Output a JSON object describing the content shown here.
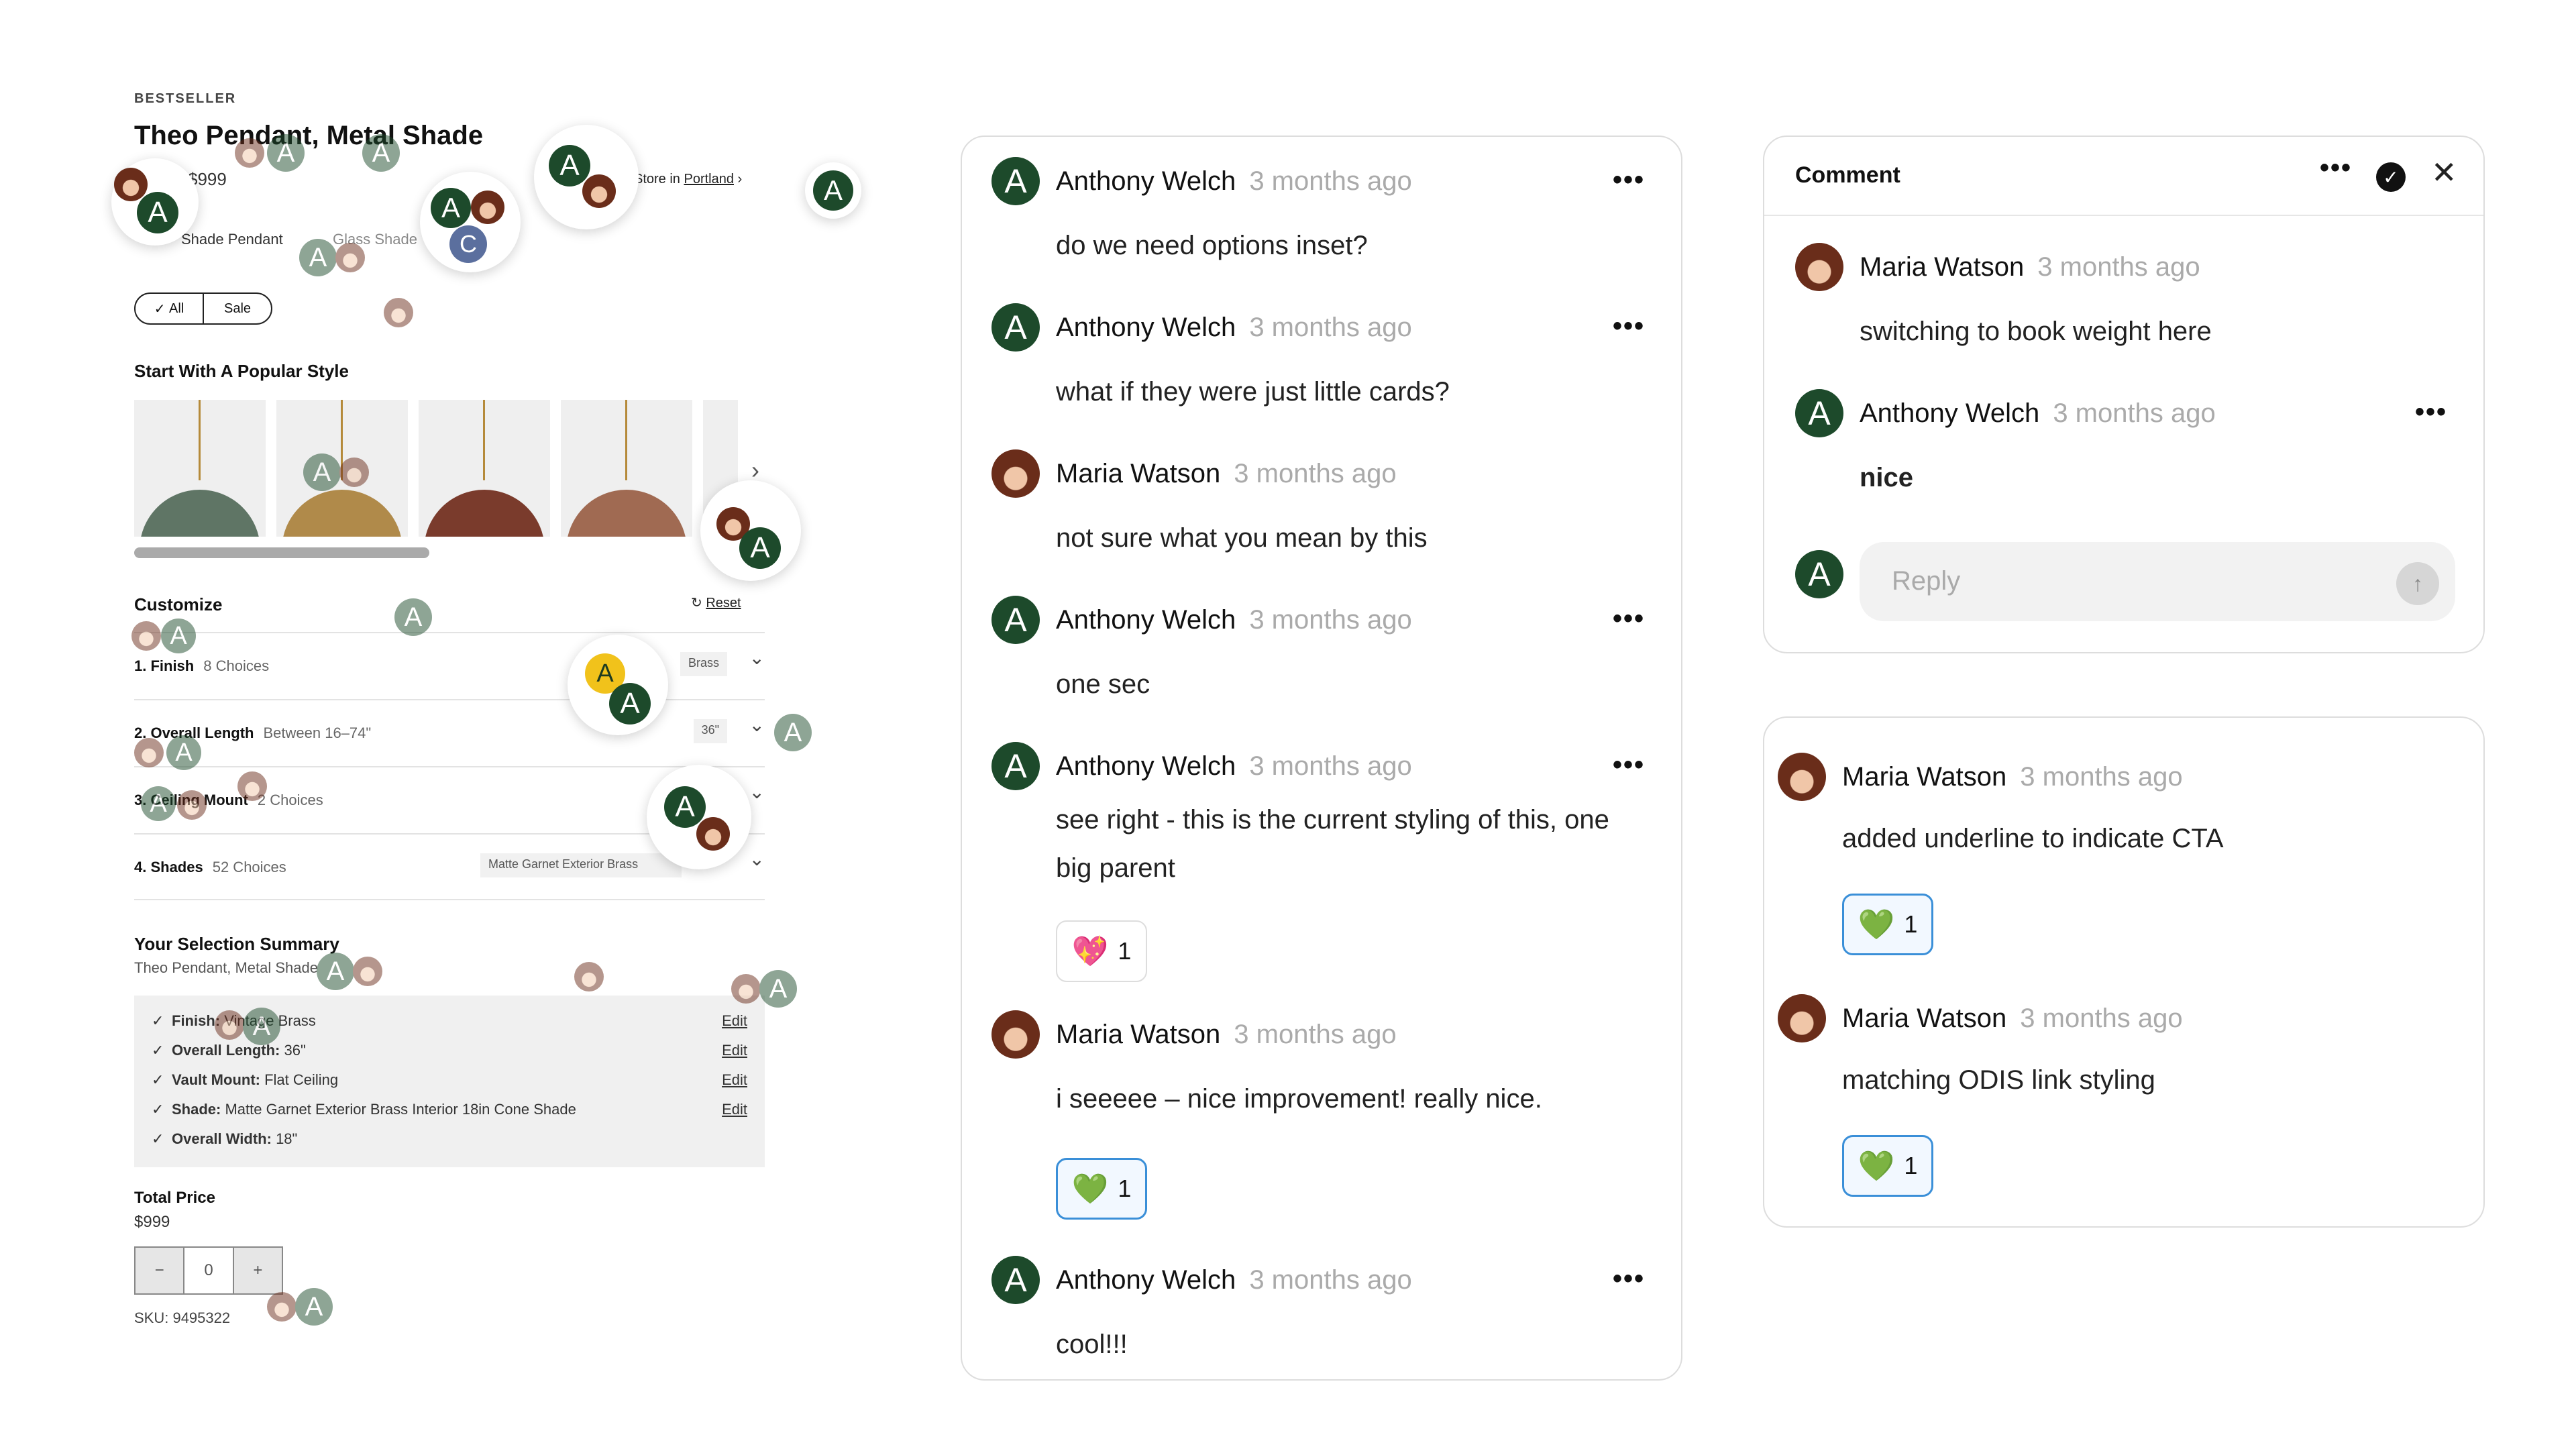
{
  "product": {
    "eyebrow": "BESTSELLER",
    "title": "Theo Pendant, Metal Shade",
    "price": "$999",
    "store_prefix": "Store in ",
    "store_city": "Portland",
    "store_chevron": "›",
    "variant_tabs": [
      "Shade Pendant",
      "Glass Shade"
    ],
    "filters": [
      "All",
      "Sale"
    ],
    "filter_check": "✓",
    "popular_heading": "Start With A Popular Style",
    "thumbnail_shade_colors": [
      "#5f7565",
      "#b08a4a",
      "#7a3b2c",
      "#a06a52",
      "#d8d8d8"
    ],
    "next_arrow": "›",
    "customize_heading": "Customize",
    "reset_icon": "↻",
    "reset_label": "Reset",
    "options": [
      {
        "label": "1.  Finish",
        "sub": "8 Choices",
        "value": "Brass",
        "chevron": "⌄"
      },
      {
        "label": "2.  Overall Length",
        "sub": "Between 16–74\"",
        "value": "36\"",
        "chevron": "⌄"
      },
      {
        "label": "3.  Ceiling Mount",
        "sub": "2 Choices",
        "value": "",
        "chevron": "⌄"
      },
      {
        "label": "4.  Shades",
        "sub": "52 Choices",
        "value": "Matte Garnet Exterior Brass",
        "chevron": "⌄"
      }
    ],
    "summary_heading": "Your Selection Summary",
    "summary_sub": "Theo Pendant, Metal Shade",
    "summary_check": "✓",
    "summary_lines": [
      {
        "key": "Finish:",
        "value": "Vintage Brass",
        "edit": "Edit"
      },
      {
        "key": "Overall Length:",
        "value": "36\"",
        "edit": "Edit"
      },
      {
        "key": "Vault Mount:",
        "value": "Flat Ceiling",
        "edit": "Edit"
      },
      {
        "key": "Shade:",
        "value": "Matte Garnet Exterior Brass Interior 18in Cone Shade",
        "edit": "Edit"
      },
      {
        "key": "Overall Width:",
        "value": "18\"",
        "edit": ""
      }
    ],
    "total_label": "Total Price",
    "total_value": "$999",
    "qty_minus": "−",
    "qty_value": "0",
    "qty_plus": "+",
    "sku": "SKU: 9495322"
  },
  "avatar_letters": {
    "anthony": "A",
    "c_user": "C"
  },
  "thread": {
    "more_icon": "•••",
    "comments": [
      {
        "author": "Anthony Welch",
        "time": "3 months ago",
        "body": "do we need options inset?",
        "avatar": "A"
      },
      {
        "author": "Anthony Welch",
        "time": "3 months ago",
        "body": "what if they were just little cards?",
        "avatar": "A"
      },
      {
        "author": "Maria Watson",
        "time": "3 months ago",
        "body": "not sure what you mean by this",
        "avatar": ""
      },
      {
        "author": "Anthony Welch",
        "time": "3 months ago",
        "body": "one sec",
        "avatar": "A"
      },
      {
        "author": "Anthony Welch",
        "time": "3 months ago",
        "body": "see right - this is the current styling of this, one big parent",
        "avatar": "A",
        "reaction": {
          "emoji": "💖",
          "count": "1"
        }
      },
      {
        "author": "Maria Watson",
        "time": "3 months ago",
        "body": "i seeeee – nice improvement! really nice.",
        "avatar": "",
        "reaction": {
          "emoji": "💚",
          "count": "1"
        }
      },
      {
        "author": "Anthony Welch",
        "time": "3 months ago",
        "body": "cool!!!",
        "avatar": "A"
      }
    ]
  },
  "comment_panel": {
    "title": "Comment",
    "more_icon": "•••",
    "resolve_icon": "✓",
    "close_icon": "✕",
    "comments": [
      {
        "author": "Maria Watson",
        "time": "3 months ago",
        "body": "switching to book weight here"
      },
      {
        "author": "Anthony Welch",
        "time": "3 months ago",
        "body": "nice",
        "avatar": "A"
      }
    ],
    "reply_avatar": "A",
    "reply_placeholder": "Reply",
    "send_icon": "↑"
  },
  "card": {
    "comments": [
      {
        "author": "Maria Watson",
        "time": "3 months ago",
        "body": "added underline to indicate CTA",
        "reaction": {
          "emoji": "💚",
          "count": "1"
        }
      },
      {
        "author": "Maria Watson",
        "time": "3 months ago",
        "body": "matching ODIS link styling",
        "reaction": {
          "emoji": "💚",
          "count": "1"
        }
      }
    ]
  }
}
